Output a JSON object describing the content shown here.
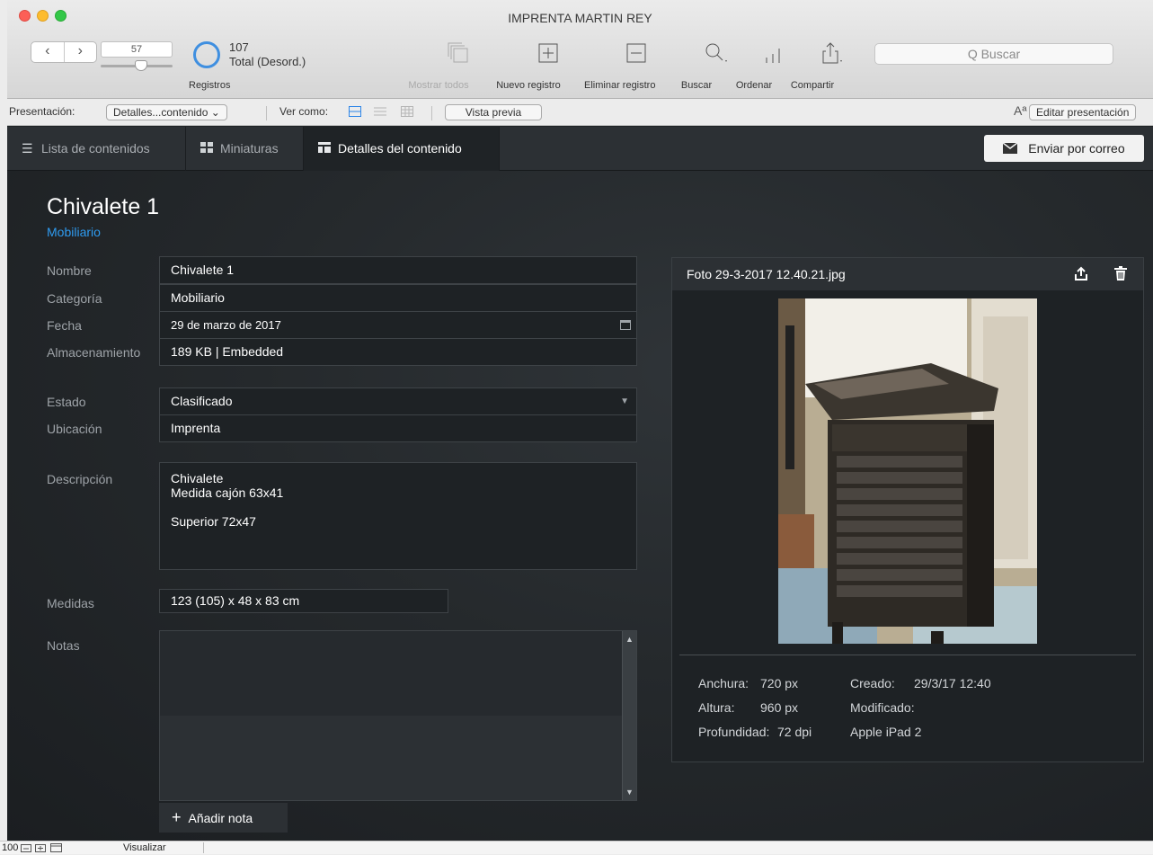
{
  "window": {
    "title": "IMPRENTA MARTIN REY"
  },
  "toolbar": {
    "record_number": "57",
    "total_count": "107",
    "total_label": "Total (Desord.)",
    "records_label": "Registros",
    "show_all": "Mostrar todos",
    "new_record": "Nuevo registro",
    "delete_record": "Eliminar registro",
    "find": "Buscar",
    "sort": "Ordenar",
    "share": "Compartir",
    "search_placeholder": "Q Buscar"
  },
  "layout_bar": {
    "layout_label": "Presentación:",
    "layout_value": "Detalles...contenido",
    "view_as_label": "Ver como:",
    "preview": "Vista previa",
    "font_icon_text": "Aª",
    "edit_layout": "Editar presentación"
  },
  "tabs": {
    "list": "Lista de contenidos",
    "thumbnails": "Miniaturas",
    "details": "Detalles del contenido",
    "email": "Enviar por correo"
  },
  "record": {
    "title": "Chivalete 1",
    "subtitle": "Mobiliario",
    "fields": {
      "nombre_label": "Nombre",
      "nombre": "Chivalete 1",
      "categoria_label": "Categoría",
      "categoria": "Mobiliario",
      "fecha_label": "Fecha",
      "fecha": "29 de marzo de 2017",
      "almacenamiento_label": "Almacenamiento",
      "almacenamiento": "189 KB | Embedded",
      "estado_label": "Estado",
      "estado": "Clasificado",
      "ubicacion_label": "Ubicación",
      "ubicacion": "Imprenta",
      "descripcion_label": "Descripción",
      "descripcion": [
        "Chivalete",
        "Medida cajón 63x41",
        "",
        "Superior 72x47"
      ],
      "medidas_label": "Medidas",
      "medidas": "123 (105) x 48 x 83 cm",
      "notas_label": "Notas",
      "add_note": "Añadir nota"
    }
  },
  "photo": {
    "filename": "Foto 29-3-2017 12.40.21.jpg",
    "anchura_label": "Anchura:",
    "anchura": "720 px",
    "altura_label": "Altura:",
    "altura": "960 px",
    "profundidad_label": "Profundidad:",
    "profundidad": "72 dpi",
    "creado_label": "Creado:",
    "creado": "29/3/17 12:40",
    "modificado_label": "Modificado:",
    "device": "Apple iPad 2"
  },
  "statusbar": {
    "zoom": "100",
    "mode": "Visualizar"
  }
}
